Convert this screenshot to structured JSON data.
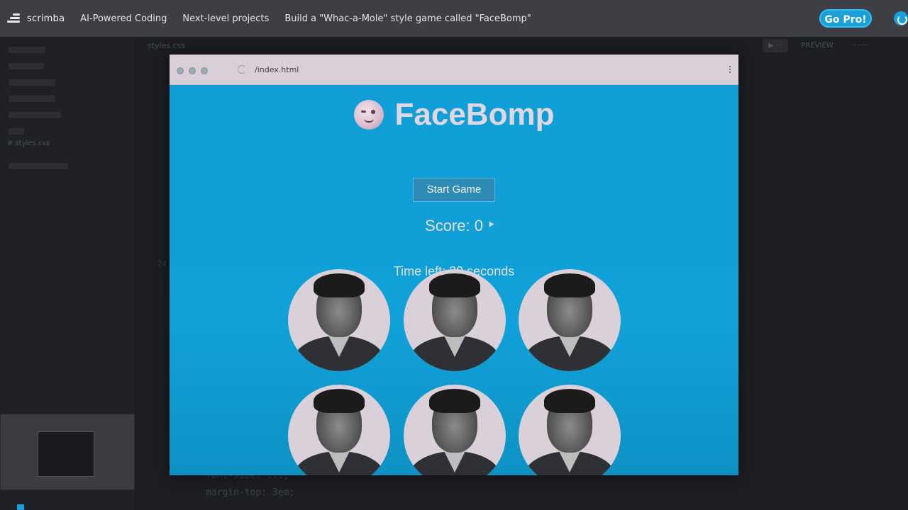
{
  "app": {
    "logo_text": "scrimba",
    "breadcrumbs": [
      "AI-Powered Coding",
      "Next-level projects",
      "Build a \"Whac-a-Mole\" style game called \"FaceBomp\""
    ],
    "go_pro_label": "Go Pro!",
    "accent_color": "#1b9fda"
  },
  "ide": {
    "editor_tab": "styles.css",
    "active_file": "# styles.css",
    "preview_tab": "PREVIEW",
    "code_lines": [
      "font-size: ...;",
      "margin-top: 3em;"
    ],
    "line_number": "24"
  },
  "browser": {
    "url": "/index.html"
  },
  "game": {
    "title": "FaceBomp",
    "start_button": "Start Game",
    "score_label": "Score: ",
    "score_value": "0",
    "time_prefix": "Time left: ",
    "time_value": "30",
    "time_suffix": " seconds",
    "background_color": "#0f9fd6",
    "hole_count": 6
  }
}
